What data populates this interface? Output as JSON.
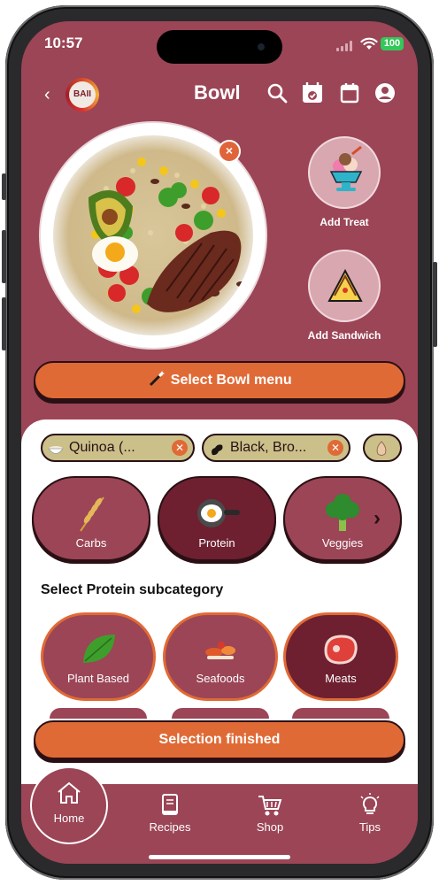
{
  "status_bar": {
    "time": "10:57",
    "battery": "100"
  },
  "header": {
    "back_glyph": "‹",
    "logo_text": "BAII",
    "title": "Bowl",
    "icons": [
      "search-icon",
      "calendar-check-icon",
      "calendar-icon",
      "account-icon"
    ]
  },
  "bowl": {
    "remove_glyph": "×"
  },
  "side_actions": {
    "treat_label": "Add Treat",
    "sandwich_label": "Add Sandwich"
  },
  "select_menu": {
    "label": "Select Bowl menu",
    "icon": "magic-wand-icon"
  },
  "chips": [
    {
      "label": "Quinoa (...",
      "icon": "bowl-icon"
    },
    {
      "label": "Black, Bro...",
      "icon": "bean-icon"
    },
    {
      "label": "",
      "icon": "onion-icon"
    }
  ],
  "categories": [
    {
      "label": "Carbs",
      "icon": "wheat-icon",
      "active": false
    },
    {
      "label": "Protein",
      "icon": "frying-pan-egg-icon",
      "active": true
    },
    {
      "label": "Veggies",
      "icon": "broccoli-icon",
      "active": false
    }
  ],
  "subcategory_title": "Select Protein subcategory",
  "subcategories": [
    {
      "label": "Plant Based",
      "icon": "leaf-icon",
      "active": false
    },
    {
      "label": "Seafoods",
      "icon": "seafood-icon",
      "active": false
    },
    {
      "label": "Meats",
      "icon": "steak-icon",
      "active": true
    }
  ],
  "finish_button": "Selection finished",
  "nav": [
    {
      "label": "Home",
      "icon": "home-icon",
      "active": true
    },
    {
      "label": "Recipes",
      "icon": "book-icon",
      "active": false
    },
    {
      "label": "Shop",
      "icon": "cart-icon",
      "active": false
    },
    {
      "label": "Tips",
      "icon": "lightbulb-icon",
      "active": false
    }
  ],
  "colors": {
    "background": "#9b4556",
    "accent": "#e06a36",
    "active": "#6e2030",
    "chip": "#cbc08a"
  }
}
